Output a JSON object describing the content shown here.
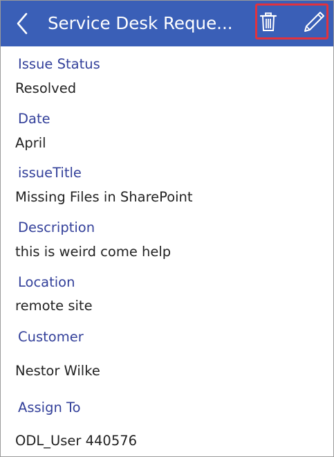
{
  "header": {
    "title": "Service Desk Reque...",
    "back_icon": "chevron-left-icon",
    "delete_icon": "trash-icon",
    "edit_icon": "pencil-icon",
    "background_color": "#3a5fb7",
    "highlight_color": "#e2323d"
  },
  "fields": [
    {
      "label": "Issue Status",
      "value": "Resolved"
    },
    {
      "label": "Date",
      "value": "April"
    },
    {
      "label": "issueTitle",
      "value": "Missing Files in SharePoint"
    },
    {
      "label": "Description",
      "value": "this is weird come help"
    },
    {
      "label": "Location",
      "value": "remote site"
    },
    {
      "label": "Customer",
      "value": "Nestor Wilke"
    },
    {
      "label": "Assign To",
      "value": "ODL_User 440576"
    }
  ],
  "colors": {
    "label": "#33409a",
    "value": "#222222"
  }
}
